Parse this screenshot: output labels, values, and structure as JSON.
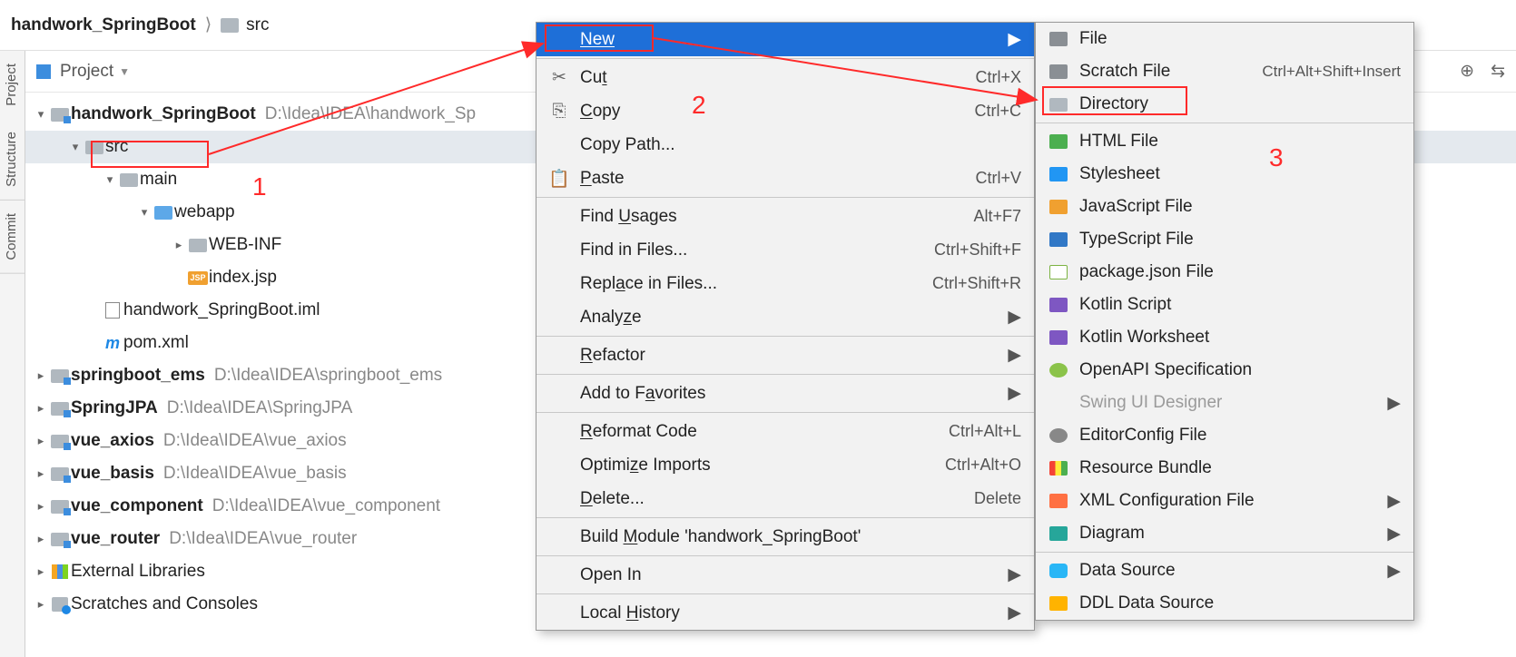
{
  "breadcrumb": {
    "root": "handwork_SpringBoot",
    "child": "src"
  },
  "project_label": "Project",
  "sidebars": [
    "Project",
    "Structure",
    "Commit"
  ],
  "tree": {
    "root": {
      "name": "handwork_SpringBoot",
      "path": "D:\\Idea\\IDEA\\handwork_Sp"
    },
    "src": "src",
    "main": "main",
    "webapp": "webapp",
    "webinf": "WEB-INF",
    "index": "index.jsp",
    "iml": "handwork_SpringBoot.iml",
    "pom": "pom.xml",
    "p": [
      {
        "name": "springboot_ems",
        "path": "D:\\Idea\\IDEA\\springboot_ems"
      },
      {
        "name": "SpringJPA",
        "path": "D:\\Idea\\IDEA\\SpringJPA"
      },
      {
        "name": "vue_axios",
        "path": "D:\\Idea\\IDEA\\vue_axios"
      },
      {
        "name": "vue_basis",
        "path": "D:\\Idea\\IDEA\\vue_basis"
      },
      {
        "name": "vue_component",
        "path": "D:\\Idea\\IDEA\\vue_component"
      },
      {
        "name": "vue_router",
        "path": "D:\\Idea\\IDEA\\vue_router"
      }
    ],
    "ext": "External Libraries",
    "scr": "Scratches and Consoles"
  },
  "ann": {
    "n1": "1",
    "n2": "2",
    "n3": "3"
  },
  "jsp_badge": "JSP",
  "m_badge": "m",
  "ctx": {
    "new": "New",
    "cut": {
      "pre": "Cu",
      "u": "t",
      "post": "",
      "sc": "Ctrl+X"
    },
    "copy": {
      "u": "C",
      "post": "opy",
      "sc": "Ctrl+C"
    },
    "copy_path": "Copy Path...",
    "paste": {
      "u": "P",
      "post": "aste",
      "sc": "Ctrl+V"
    },
    "find_usages": {
      "pre": "Find ",
      "u": "U",
      "post": "sages",
      "sc": "Alt+F7"
    },
    "find_files": {
      "label": "Find in Files...",
      "sc": "Ctrl+Shift+F"
    },
    "replace_files": {
      "pre": "Repl",
      "u": "a",
      "post": "ce in Files...",
      "sc": "Ctrl+Shift+R"
    },
    "analyze": {
      "pre": "Analy",
      "u": "z",
      "post": "e"
    },
    "refactor": {
      "u": "R",
      "post": "efactor"
    },
    "favorites": {
      "pre": "Add to F",
      "u": "a",
      "post": "vorites"
    },
    "reformat": {
      "u": "R",
      "post": "eformat Code",
      "sc": "Ctrl+Alt+L"
    },
    "optimize": {
      "pre": "Optimi",
      "u": "z",
      "post": "e Imports",
      "sc": "Ctrl+Alt+O"
    },
    "delete": {
      "u": "D",
      "post": "elete...",
      "sc": "Delete"
    },
    "build": {
      "pre": "Build ",
      "u": "M",
      "post": "odule 'handwork_SpringBoot'"
    },
    "open_in": "Open In",
    "history": {
      "pre": "Local ",
      "u": "H",
      "post": "istory"
    }
  },
  "sub": {
    "file": "File",
    "scratch": {
      "label": "Scratch File",
      "sc": "Ctrl+Alt+Shift+Insert"
    },
    "dir": "Directory",
    "html": "HTML File",
    "css": "Stylesheet",
    "js": "JavaScript File",
    "ts": "TypeScript File",
    "pkg": "package.json File",
    "kts": "Kotlin Script",
    "ktw": "Kotlin Worksheet",
    "api": "OpenAPI Specification",
    "swing": "Swing UI Designer",
    "ec": "EditorConfig File",
    "rb": "Resource Bundle",
    "xml": "XML Configuration File",
    "dia": "Diagram",
    "ds": "Data Source",
    "ddl": "DDL Data Source"
  }
}
